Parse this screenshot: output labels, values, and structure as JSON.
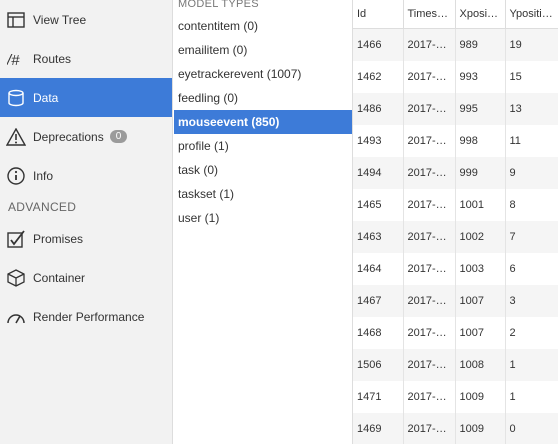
{
  "sidebar": {
    "items": [
      {
        "label": "View Tree",
        "icon": "view-tree-icon"
      },
      {
        "label": "Routes",
        "icon": "routes-icon"
      },
      {
        "label": "Data",
        "icon": "data-icon",
        "active": true
      },
      {
        "label": "Deprecations",
        "icon": "warning-icon",
        "badge": "0"
      },
      {
        "label": "Info",
        "icon": "info-icon"
      }
    ],
    "advanced_label": "ADVANCED",
    "advanced_items": [
      {
        "label": "Promises",
        "icon": "promises-icon"
      },
      {
        "label": "Container",
        "icon": "container-icon"
      },
      {
        "label": "Render Performance",
        "icon": "render-performance-icon"
      }
    ]
  },
  "models": {
    "header": "MODEL TYPES",
    "items": [
      {
        "label": "contentitem (0)"
      },
      {
        "label": "emailitem (0)"
      },
      {
        "label": "eyetrackerevent (1007)"
      },
      {
        "label": "feedling (0)"
      },
      {
        "label": "mouseevent (850)",
        "active": true
      },
      {
        "label": "profile (1)"
      },
      {
        "label": "task (0)"
      },
      {
        "label": "taskset (1)"
      },
      {
        "label": "user (1)"
      }
    ]
  },
  "table": {
    "columns": [
      "Id",
      "Timesta...",
      "Xposition",
      "Yposition"
    ],
    "rows": [
      [
        "1466",
        "2017-0...",
        "989",
        "19"
      ],
      [
        "1462",
        "2017-0...",
        "993",
        "15"
      ],
      [
        "1486",
        "2017-0...",
        "995",
        "13"
      ],
      [
        "1493",
        "2017-0...",
        "998",
        "11"
      ],
      [
        "1494",
        "2017-0...",
        "999",
        "9"
      ],
      [
        "1465",
        "2017-0...",
        "1001",
        "8"
      ],
      [
        "1463",
        "2017-0...",
        "1002",
        "7"
      ],
      [
        "1464",
        "2017-0...",
        "1003",
        "6"
      ],
      [
        "1467",
        "2017-0...",
        "1007",
        "3"
      ],
      [
        "1468",
        "2017-0...",
        "1007",
        "2"
      ],
      [
        "1506",
        "2017-0...",
        "1008",
        "1"
      ],
      [
        "1471",
        "2017-0...",
        "1009",
        "1"
      ],
      [
        "1469",
        "2017-0...",
        "1009",
        "0"
      ]
    ]
  },
  "colors": {
    "accent": "#3d7bd8",
    "sidebar_bg": "#f2f2f2",
    "badge": "#9b9b9b"
  }
}
